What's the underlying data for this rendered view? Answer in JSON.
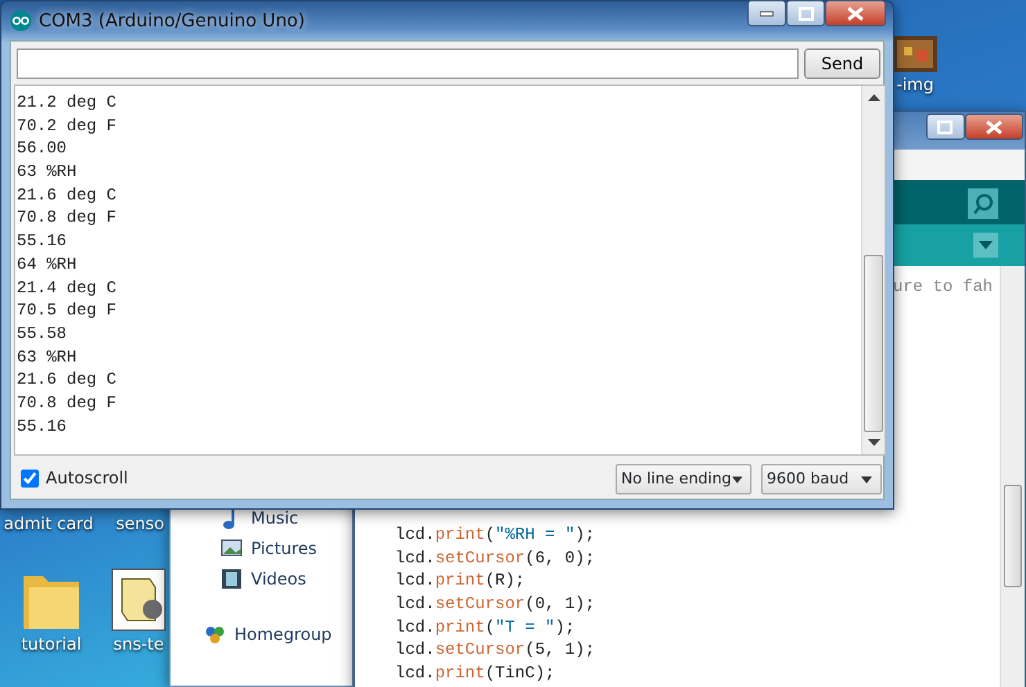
{
  "desktop_icons": [
    {
      "label": "-img",
      "kind": "image"
    },
    {
      "label": "admit card"
    },
    {
      "label": "senso"
    },
    {
      "label": "tutorial",
      "kind": "folder"
    },
    {
      "label": "sns-te",
      "kind": "script"
    }
  ],
  "explorer": {
    "items": [
      {
        "label": "Music",
        "kind": "music"
      },
      {
        "label": "Pictures",
        "kind": "pictures"
      },
      {
        "label": "Videos",
        "kind": "videos"
      },
      {
        "label": "Homegroup",
        "kind": "homegroup"
      }
    ]
  },
  "ide": {
    "comment_fragment": "ure to fah",
    "code_lines": [
      [
        {
          "text": "lcd.",
          "kind": "plain"
        },
        {
          "text": "print",
          "kind": "func"
        },
        {
          "text": "(",
          "kind": "plain"
        },
        {
          "text": "\"%RH = \"",
          "kind": "string"
        },
        {
          "text": ");",
          "kind": "plain"
        }
      ],
      [
        {
          "text": "lcd.",
          "kind": "plain"
        },
        {
          "text": "setCursor",
          "kind": "func"
        },
        {
          "text": "(6, 0);",
          "kind": "plain"
        }
      ],
      [
        {
          "text": "lcd.",
          "kind": "plain"
        },
        {
          "text": "print",
          "kind": "func"
        },
        {
          "text": "(R);",
          "kind": "plain"
        }
      ],
      [
        {
          "text": "lcd.",
          "kind": "plain"
        },
        {
          "text": "setCursor",
          "kind": "func"
        },
        {
          "text": "(0, 1);",
          "kind": "plain"
        }
      ],
      [
        {
          "text": "lcd.",
          "kind": "plain"
        },
        {
          "text": "print",
          "kind": "func"
        },
        {
          "text": "(",
          "kind": "plain"
        },
        {
          "text": "\"T = \"",
          "kind": "string"
        },
        {
          "text": ");",
          "kind": "plain"
        }
      ],
      [
        {
          "text": "lcd.",
          "kind": "plain"
        },
        {
          "text": "setCursor",
          "kind": "func"
        },
        {
          "text": "(5, 1);",
          "kind": "plain"
        }
      ],
      [
        {
          "text": "lcd.",
          "kind": "plain"
        },
        {
          "text": "print",
          "kind": "func"
        },
        {
          "text": "(TinC);",
          "kind": "plain"
        }
      ]
    ]
  },
  "serial_monitor": {
    "title": "COM3 (Arduino/Genuino Uno)",
    "send_button": "Send",
    "output": [
      "21.2 deg C",
      "70.2 deg F",
      "56.00",
      "63 %RH",
      "21.6 deg C",
      "70.8 deg F",
      "55.16",
      "64 %RH",
      "21.4 deg C",
      "70.5 deg F",
      "55.58",
      "63 %RH",
      "21.6 deg C",
      "70.8 deg F",
      "55.16"
    ],
    "autoscroll": {
      "label": "Autoscroll",
      "checked": true
    },
    "line_ending": "No line ending",
    "baud": "9600 baud"
  }
}
